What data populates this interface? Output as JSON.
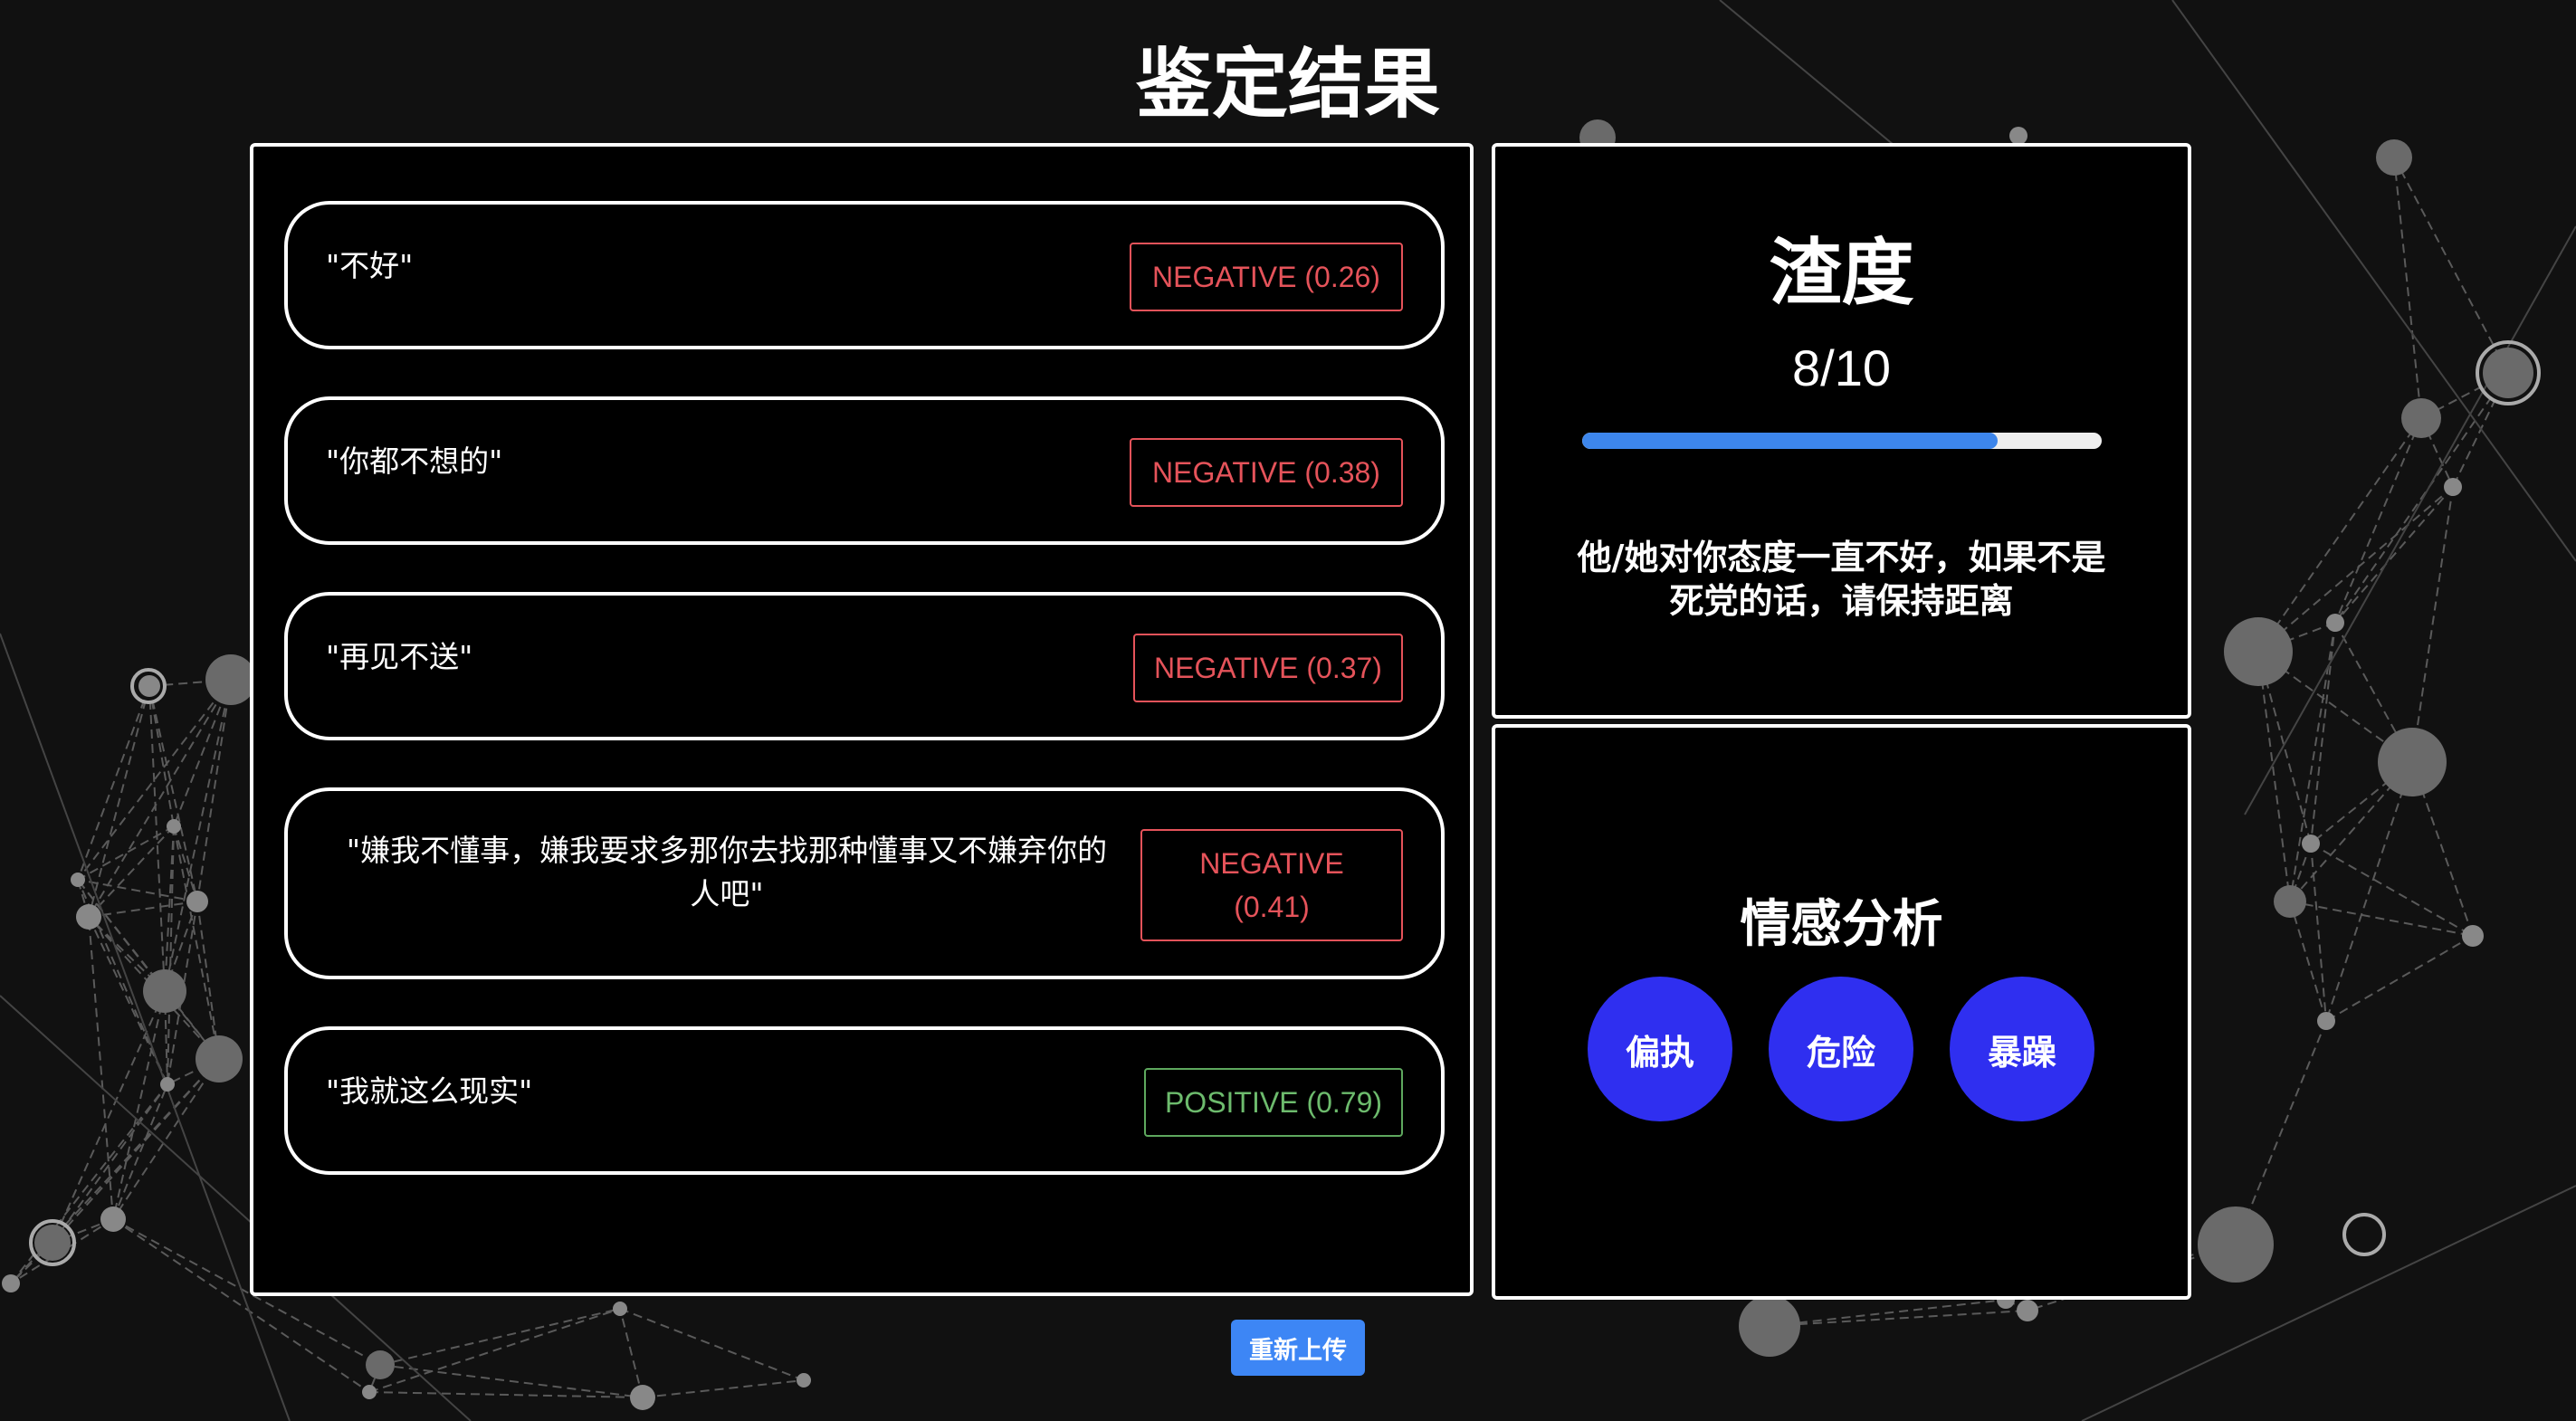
{
  "page": {
    "title": "鉴定结果"
  },
  "messages": [
    {
      "text": "\"不好\"",
      "label": "NEGATIVE (0.26)",
      "sentiment": "negative",
      "score": 0.26
    },
    {
      "text": "\"你都不想的\"",
      "label": "NEGATIVE (0.38)",
      "sentiment": "negative",
      "score": 0.38
    },
    {
      "text": "\"再见不送\"",
      "label": "NEGATIVE (0.37)",
      "sentiment": "negative",
      "score": 0.37
    },
    {
      "text": "\"嫌我不懂事，嫌我要求多那你去找那种懂事又不嫌弃你的人吧\"",
      "label_line1": "NEGATIVE",
      "label_line2": "(0.41)",
      "sentiment": "negative",
      "score": 0.41
    },
    {
      "text": "\"我就这么现实\"",
      "label": "POSITIVE (0.79)",
      "sentiment": "positive",
      "score": 0.79
    }
  ],
  "score_card": {
    "title": "渣度",
    "value_text": "8/10",
    "progress_fraction": 0.8,
    "comment": "他/她对你态度一直不好，如果不是死党的话，请保持距离"
  },
  "emotion_card": {
    "title": "情感分析",
    "tags": [
      "偏执",
      "危险",
      "暴躁"
    ]
  },
  "actions": {
    "reupload_label": "重新上传"
  },
  "colors": {
    "negative": "#e5535a",
    "positive": "#6dbb6d",
    "progress": "#3d86ec",
    "tag_bg": "#2f2ff0",
    "button": "#3d86f5"
  }
}
